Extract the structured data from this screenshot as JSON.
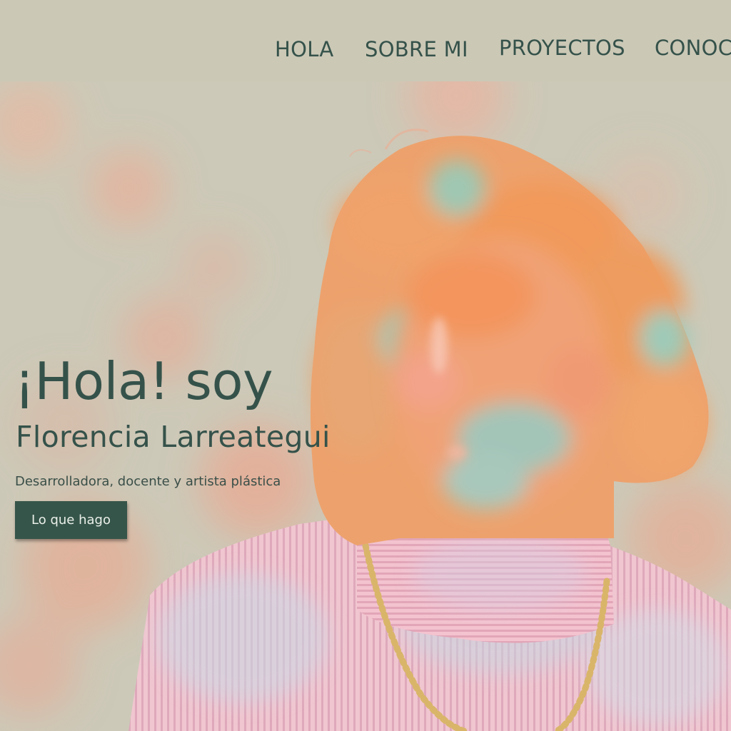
{
  "nav": {
    "items": [
      {
        "label": "HOLA"
      },
      {
        "label": "SOBRE MI"
      },
      {
        "label": "PROYECTOS"
      },
      {
        "label": "CONOC"
      }
    ]
  },
  "hero": {
    "greeting": "¡Hola! soy",
    "name": "Florencia Larreategui",
    "subtitle": "Desarrolladora, docente y artista plástica",
    "cta_label": "Lo que hago"
  },
  "colors": {
    "background": "#cbc8b6",
    "accent": "#35524a",
    "button_bg": "#36554a",
    "button_text": "#e9efe9"
  }
}
